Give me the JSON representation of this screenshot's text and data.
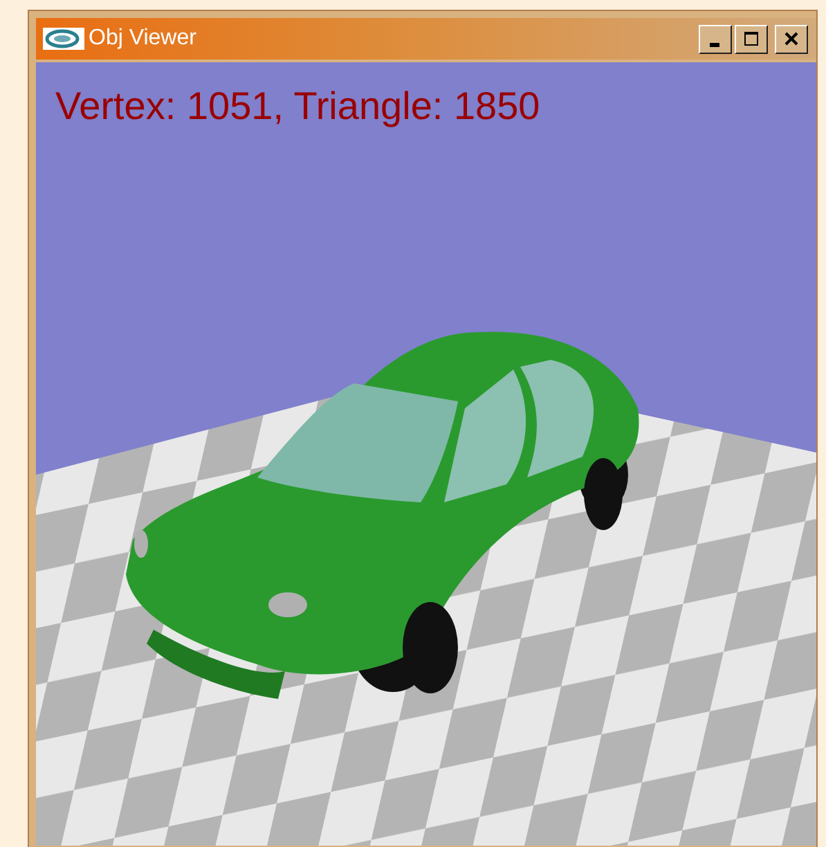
{
  "window": {
    "title": "Obj Viewer"
  },
  "viewport": {
    "overlay_text": "Vertex: 1051, Triangle: 1850"
  }
}
